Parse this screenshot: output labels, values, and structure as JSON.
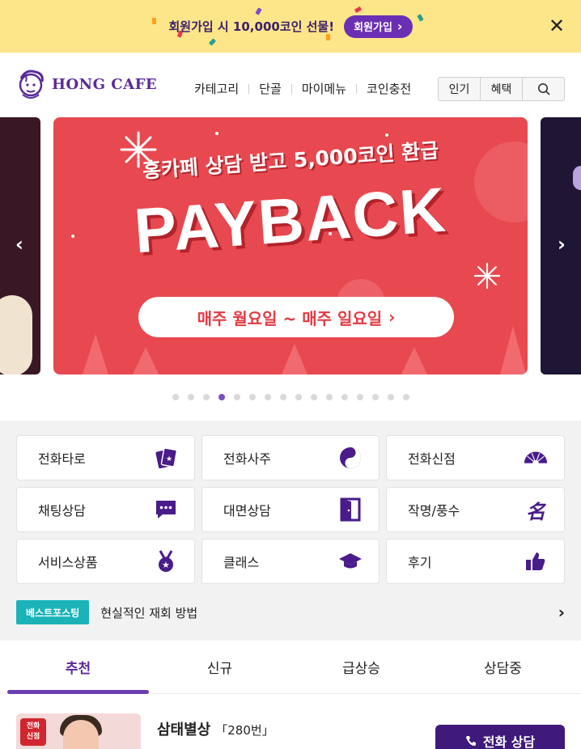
{
  "promo": {
    "text": "회원가입 시 10,000코인 선물!",
    "button_label": "회원가입",
    "button_chevron": "›",
    "close_label": "✕"
  },
  "header": {
    "logo_text": "HONG CAFE",
    "nav": [
      "카테고리",
      "단골",
      "마이메뉴",
      "코인충전"
    ],
    "segments": [
      "인기",
      "혜택"
    ]
  },
  "banner": {
    "subtitle": "홍카페 상담 받고 5,000코인 환급",
    "title": "PAYBACK",
    "pill_text": "매주 월요일 ~ 매주 일요일",
    "pill_chevron": "›",
    "prev_arrow": "‹",
    "next_arrow": "›",
    "page_count": 16,
    "active_page": 4
  },
  "categories": [
    {
      "label": "전화타로",
      "icon": "tarot-cards-icon"
    },
    {
      "label": "전화사주",
      "icon": "yin-yang-icon"
    },
    {
      "label": "전화신점",
      "icon": "fan-icon"
    },
    {
      "label": "채팅상담",
      "icon": "chat-bubble-icon"
    },
    {
      "label": "대면상담",
      "icon": "door-icon"
    },
    {
      "label": "작명/풍수",
      "icon": "name-hanja-icon"
    },
    {
      "label": "서비스상품",
      "icon": "medal-icon"
    },
    {
      "label": "클래스",
      "icon": "graduation-cap-icon"
    },
    {
      "label": "후기",
      "icon": "thumbs-up-icon"
    }
  ],
  "best": {
    "badge": "베스트포스팅",
    "text": "현실적인 재회 방법",
    "chevron": "›"
  },
  "tabs": [
    "추천",
    "신규",
    "급상승",
    "상담중"
  ],
  "listing": {
    "badge_line1": "전화",
    "badge_line2": "신점",
    "name": "삼태별상",
    "number": "「280번」",
    "call_label": "전화 상담"
  },
  "colors": {
    "promo_bg": "#fde68a",
    "brand_purple": "#5b2a9a",
    "banner_red": "#e8484f",
    "badge_teal": "#1bb3b8"
  }
}
